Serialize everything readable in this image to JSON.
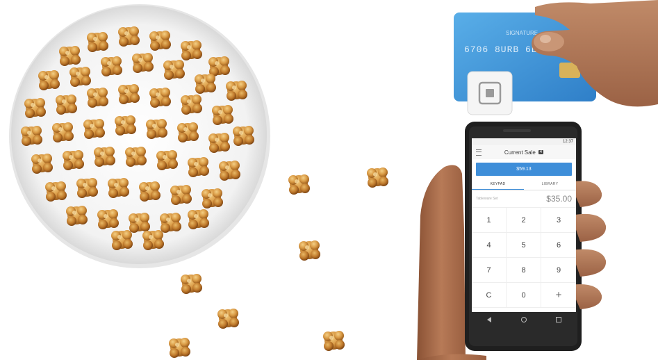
{
  "card": {
    "number_text": "6706 8URB 6EXY Y9Y3",
    "name_text": "SIGNATURE"
  },
  "phone": {
    "status_time": "12:37",
    "title": "Current Sale",
    "item_count": "4",
    "charge_label": "$59.13",
    "tabs": [
      "KEYPAD",
      "LIBRARY"
    ],
    "entry_label": "Tableware Set",
    "entry_amount": "$35.00",
    "keys": [
      "1",
      "2",
      "3",
      "4",
      "5",
      "6",
      "7",
      "8",
      "9",
      "C",
      "0",
      "+"
    ]
  }
}
